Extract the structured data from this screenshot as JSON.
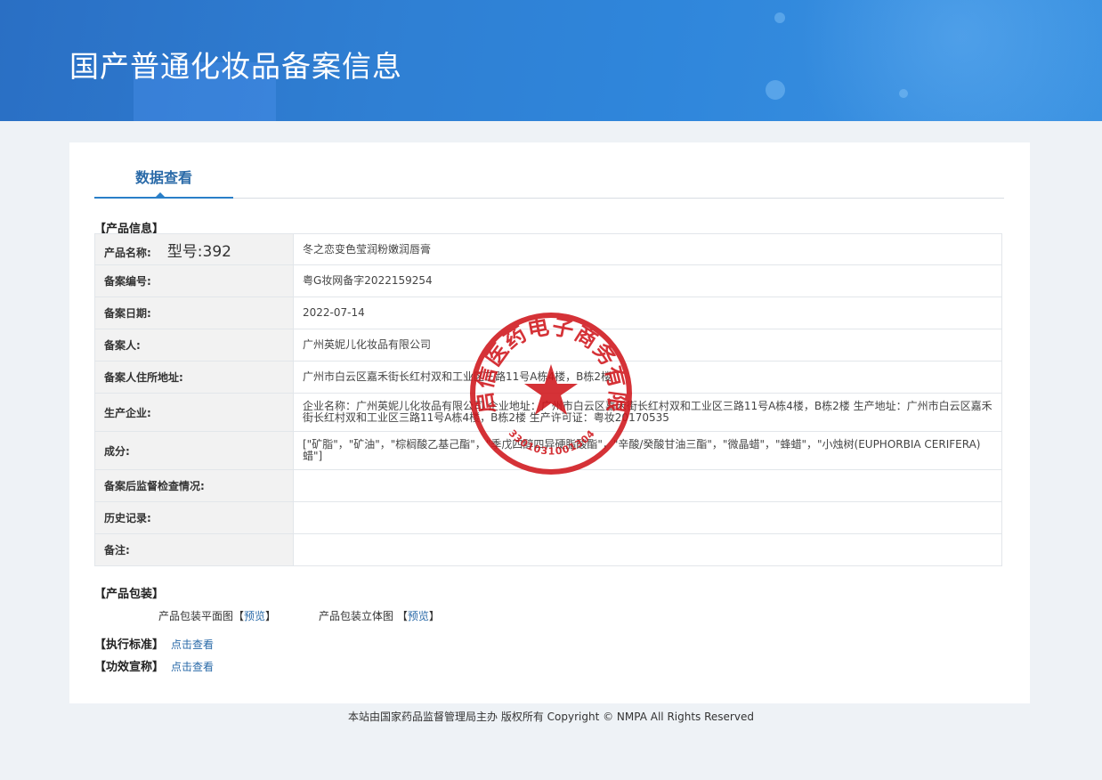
{
  "header": {
    "title": "国产普通化妆品备案信息"
  },
  "tabs": [
    {
      "label": "数据查看"
    }
  ],
  "product_info": {
    "section_label": "【产品信息】",
    "model_tag": "型号:392",
    "rows": [
      {
        "label": "产品名称:",
        "value": "冬之恋变色莹润粉嫩润唇膏"
      },
      {
        "label": "备案编号:",
        "value": "粤G妆网备字2022159254"
      },
      {
        "label": "备案日期:",
        "value": "2022-07-14"
      },
      {
        "label": "备案人:",
        "value": "广州英妮儿化妆品有限公司"
      },
      {
        "label": "备案人住所地址:",
        "value": "广州市白云区嘉禾街长红村双和工业区三路11号A栋4楼，B栋2楼"
      },
      {
        "label": "生产企业:",
        "value": "企业名称：广州英妮儿化妆品有限公司 企业地址：广州市白云区嘉禾街长红村双和工业区三路11号A栋4楼，B栋2楼 生产地址：广州市白云区嘉禾街长红村双和工业区三路11号A栋4楼，B栋2楼 生产许可证：粤妆20170535"
      },
      {
        "label": "成分:",
        "value": "[\"矿脂\"，\"矿油\"，\"棕榈酸乙基己酯\"，\"季戊四醇四异硬脂酸酯\"，\"辛酸/癸酸甘油三酯\"，\"微晶蜡\"，\"蜂蜡\"，\"小烛树(EUPHORBIA CERIFERA)蜡\"]"
      },
      {
        "label": "备案后监督检查情况:",
        "value": ""
      },
      {
        "label": "历史记录:",
        "value": ""
      },
      {
        "label": "备注:",
        "value": ""
      }
    ]
  },
  "packaging": {
    "section_label": "【产品包装】",
    "flat_label": "产品包装平面图",
    "flat_link": "预览",
    "stereo_label": "产品包装立体图",
    "stereo_link": "预览",
    "bracket_open": "【",
    "bracket_close": "】"
  },
  "standard": {
    "label": "【执行标准】",
    "link": "点击查看"
  },
  "efficacy": {
    "label": "【功效宣称】",
    "link": "点击查看"
  },
  "footer": {
    "text": "本站由国家药品监督管理局主办 版权所有 Copyright © NMPA All Rights Reserved"
  },
  "seal": {
    "arc_text": "杭州启信医药电子商务有限公司",
    "number": "3301031001304",
    "color": "#d0161c"
  },
  "colors": {
    "banner": "#2f7fd3",
    "accent": "#2a6aa8",
    "table_border": "#9fbcd6",
    "label_bg": "#f2f2f2"
  }
}
